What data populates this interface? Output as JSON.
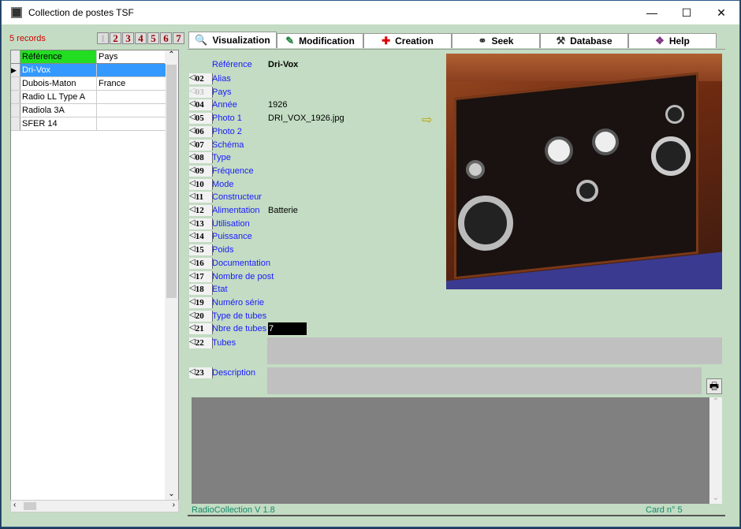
{
  "window": {
    "title": "Collection de postes TSF",
    "minimize": "—",
    "maximize": "☐",
    "close": "✕"
  },
  "left": {
    "records": "5 records",
    "pages": [
      "1",
      "2",
      "3",
      "4",
      "5",
      "6",
      "7"
    ],
    "columns": [
      "Référence",
      "Pays"
    ],
    "rows": [
      {
        "ref": "Dri-Vox",
        "pays": "",
        "selected": true
      },
      {
        "ref": "Dubois-Maton",
        "pays": "France"
      },
      {
        "ref": "Radio LL Type A",
        "pays": ""
      },
      {
        "ref": "Radiola 3A",
        "pays": ""
      },
      {
        "ref": "SFER 14",
        "pays": ""
      }
    ]
  },
  "tabs": [
    {
      "label": "Visualization",
      "icon": "magnifier-icon",
      "active": true
    },
    {
      "label": "Modification",
      "icon": "edit-icon"
    },
    {
      "label": "Creation",
      "icon": "red-cross-icon"
    },
    {
      "label": "Seek",
      "icon": "binoculars-icon"
    },
    {
      "label": "Database",
      "icon": "tools-icon"
    },
    {
      "label": "Help",
      "icon": "book-icon"
    }
  ],
  "record": {
    "reference_label": "Référence",
    "reference_value": "Dri-Vox",
    "fields": [
      {
        "n": "02",
        "label": "Alias",
        "value": ""
      },
      {
        "n": "03",
        "label": "Pays",
        "value": "",
        "disabled": true
      },
      {
        "n": "04",
        "label": "Année",
        "value": "1926"
      },
      {
        "n": "05",
        "label": "Photo 1",
        "value": "DRI_VOX_1926.jpg"
      },
      {
        "n": "06",
        "label": "Photo 2",
        "value": ""
      },
      {
        "n": "07",
        "label": "Schéma",
        "value": ""
      },
      {
        "n": "08",
        "label": "Type",
        "value": ""
      },
      {
        "n": "09",
        "label": "Fréquence",
        "value": ""
      },
      {
        "n": "10",
        "label": "Mode",
        "value": ""
      },
      {
        "n": "11",
        "label": "Constructeur",
        "value": ""
      },
      {
        "n": "12",
        "label": "Alimentation",
        "value": "Batterie"
      },
      {
        "n": "13",
        "label": "Utilisation",
        "value": ""
      },
      {
        "n": "14",
        "label": "Puissance",
        "value": ""
      },
      {
        "n": "15",
        "label": "Poids",
        "value": ""
      },
      {
        "n": "16",
        "label": "Documentation",
        "value": ""
      },
      {
        "n": "17",
        "label": "Nombre de post",
        "value": ""
      },
      {
        "n": "18",
        "label": "Etat",
        "value": ""
      },
      {
        "n": "19",
        "label": "Numéro série",
        "value": ""
      },
      {
        "n": "20",
        "label": "Type de tubes",
        "value": ""
      },
      {
        "n": "21",
        "label": "Nbre de tubes",
        "value": "7"
      },
      {
        "n": "22",
        "label": "Tubes",
        "value": ""
      },
      {
        "n": "23",
        "label": "Description",
        "value": ""
      }
    ]
  },
  "footer": {
    "version": "RadioCollection V 1.8",
    "card": "Card n°  5"
  }
}
